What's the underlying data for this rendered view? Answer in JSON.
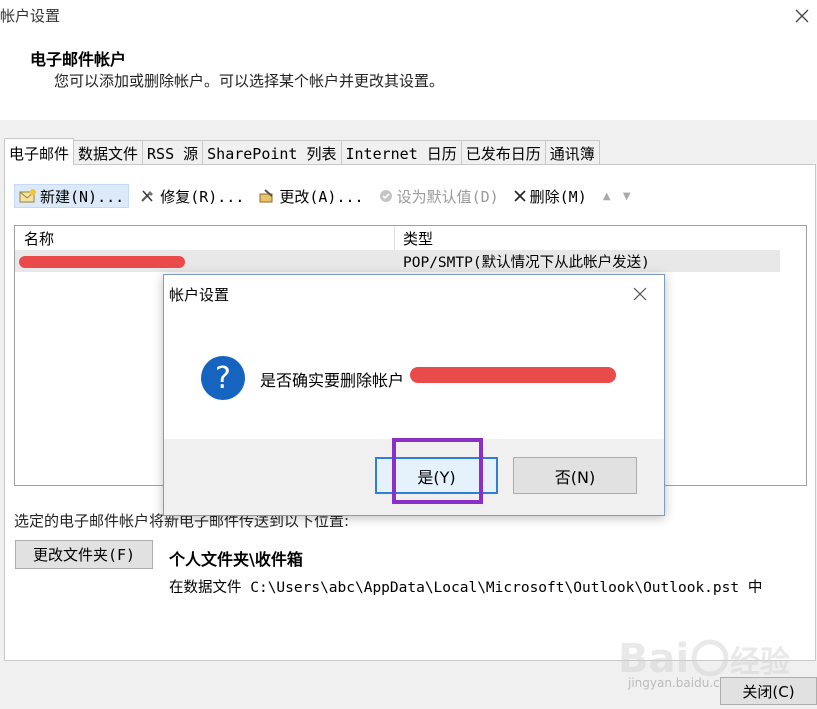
{
  "window": {
    "title": "帐户设置"
  },
  "header": {
    "title": "电子邮件帐户",
    "description": "您可以添加或删除帐户。可以选择某个帐户并更改其设置。"
  },
  "tabs": [
    {
      "label": "电子邮件",
      "active": true
    },
    {
      "label": "数据文件"
    },
    {
      "label": "RSS 源"
    },
    {
      "label": "SharePoint 列表"
    },
    {
      "label": "Internet 日历"
    },
    {
      "label": "已发布日历"
    },
    {
      "label": "通讯簿"
    }
  ],
  "toolbar": {
    "new_label": "新建(N)...",
    "repair_label": "修复(R)...",
    "change_label": "更改(A)...",
    "set_default_label": "设为默认值(D)",
    "delete_label": "删除(M)",
    "icons": [
      "new-mail-icon",
      "repair-tools-icon",
      "change-icon",
      "check-circle-icon",
      "close-x-icon",
      "move-up-icon",
      "move-down-icon"
    ]
  },
  "account_list": {
    "columns": [
      "名称",
      "类型"
    ],
    "rows": [
      {
        "name": "[redacted]",
        "type": "POP/SMTP(默认情况下从此帐户发送)"
      }
    ]
  },
  "delivery": {
    "text": "选定的电子邮件帐户将新电子邮件传送到以下位置:",
    "change_folder_label": "更改文件夹(F)",
    "folder_name": "个人文件夹\\收件箱",
    "folder_path": "在数据文件 C:\\Users\\abc\\AppData\\Local\\Microsoft\\Outlook\\Outlook.pst 中"
  },
  "footer": {
    "close_label": "关闭(C)"
  },
  "dialog": {
    "title": "帐户设置",
    "message": "是否确实要删除帐户",
    "yes_label": "是(Y)",
    "no_label": "否(N)",
    "icon": "question-icon"
  },
  "watermark": {
    "text": "Bai du 经验",
    "url": "jingyan.baidu.com"
  },
  "colors": {
    "accent": "#2d7fd8",
    "redaction": "#e94b4b",
    "highlight": "#8b2fc9",
    "question_icon": "#1565c0"
  }
}
